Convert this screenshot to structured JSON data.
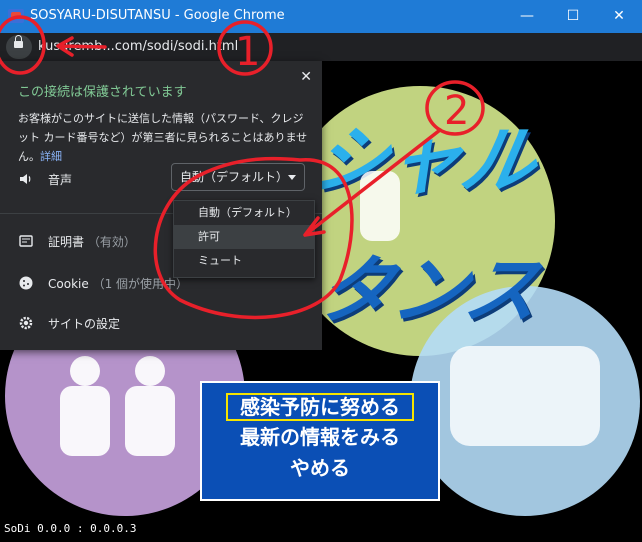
{
  "window": {
    "title": "SOSYARU-DISUTANSU - Google Chrome",
    "minimize": "—",
    "maximize": "☐",
    "close": "✕"
  },
  "addressbar": {
    "url": "kusuremb...com/sodi/sodi.html"
  },
  "popup": {
    "header": "この接続は保護されています",
    "description": "お客様がこのサイトに送信した情報（パスワード、クレジット カード番号など）が第三者に見られることはありません。",
    "details_link": "詳細",
    "close": "✕",
    "sound_label": "音声",
    "sound_value": "自動（デフォルト）",
    "certificate_label": "証明書",
    "certificate_status": "（有効）",
    "cookie_label": "Cookie",
    "cookie_status": "（1 個が使用中）",
    "site_settings_label": "サイトの設定"
  },
  "dropdown": {
    "options": [
      "自動（デフォルト）",
      "許可",
      "ミュート"
    ],
    "highlighted_index": 1
  },
  "game": {
    "menu": [
      "感染予防に努める",
      "最新の情報をみる",
      "やめる"
    ],
    "selected_index": 0,
    "title_line1": "シャル",
    "title_line2": "タンス",
    "version": "SoDi 0.0.0 : 0.0.0.3"
  },
  "annotations": {
    "mark1": "1",
    "mark2": "2",
    "color": "#e8202a"
  }
}
